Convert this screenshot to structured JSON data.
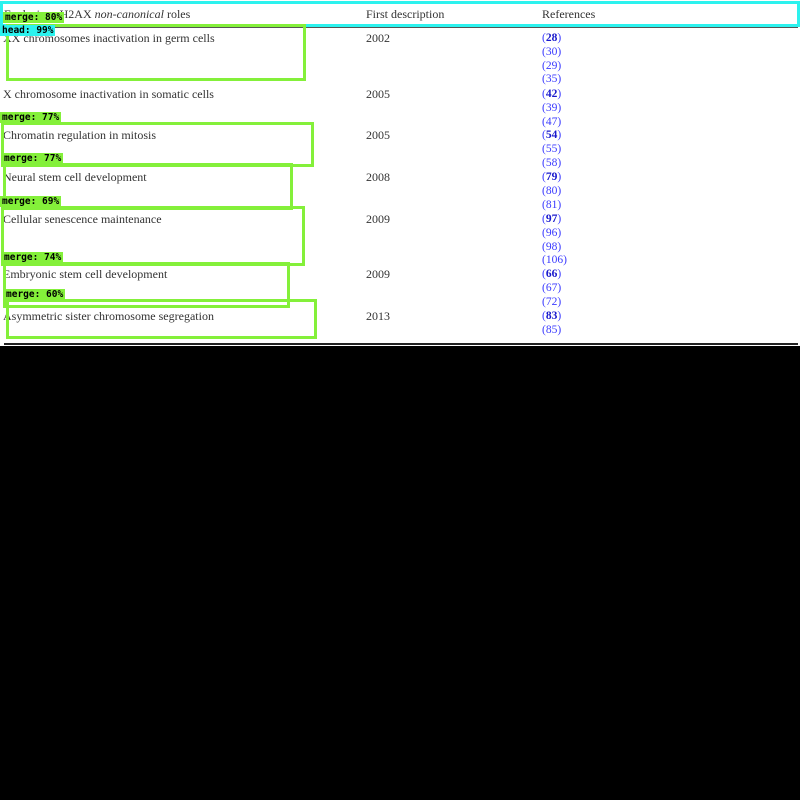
{
  "table": {
    "header": {
      "col1_prefix": "Exclusive γH2AX",
      "col1_italic": "non-canonical",
      "col1_suffix": "roles",
      "col2": "First description",
      "col3": "References"
    },
    "rows": [
      {
        "role": "XX chromosomes inactivation in germ cells",
        "year": "2002",
        "refs": [
          {
            "num": "28",
            "bold": true
          },
          {
            "num": "30",
            "bold": false
          },
          {
            "num": "29",
            "bold": false
          },
          {
            "num": "35",
            "bold": false
          }
        ]
      },
      {
        "role": "X chromosome inactivation in somatic cells",
        "year": "2005",
        "refs": [
          {
            "num": "42",
            "bold": true
          },
          {
            "num": "39",
            "bold": false
          },
          {
            "num": "47",
            "bold": false
          }
        ]
      },
      {
        "role": "Chromatin regulation in mitosis",
        "year": "2005",
        "refs": [
          {
            "num": "54",
            "bold": true
          },
          {
            "num": "55",
            "bold": false
          },
          {
            "num": "58",
            "bold": false
          }
        ]
      },
      {
        "role": "Neural stem cell development",
        "year": "2008",
        "refs": [
          {
            "num": "79",
            "bold": true
          },
          {
            "num": "80",
            "bold": false
          },
          {
            "num": "81",
            "bold": false
          }
        ]
      },
      {
        "role": "Cellular senescence maintenance",
        "year": "2009",
        "refs": [
          {
            "num": "97",
            "bold": true
          },
          {
            "num": "96",
            "bold": false
          },
          {
            "num": "98",
            "bold": false
          },
          {
            "num": "106",
            "bold": false
          }
        ]
      },
      {
        "role": "Embryonic stem cell development",
        "year": "2009",
        "refs": [
          {
            "num": "66",
            "bold": true
          },
          {
            "num": "67",
            "bold": false
          },
          {
            "num": "72",
            "bold": false
          }
        ]
      },
      {
        "role": "Asymmetric sister chromosome segregation",
        "year": "2013",
        "refs": [
          {
            "num": "83",
            "bold": true
          },
          {
            "num": "85",
            "bold": false
          }
        ]
      }
    ]
  },
  "overlay": {
    "head_label": "head: 99%",
    "header_merge_label": "merge: 80%",
    "merge_labels": [
      "merge: 77%",
      "merge: 77%",
      "merge: 69%",
      "merge: 74%",
      "merge: 60%"
    ],
    "colors": {
      "merge": "#84f03a",
      "head": "#2cf2ee",
      "background": "#000000"
    }
  }
}
